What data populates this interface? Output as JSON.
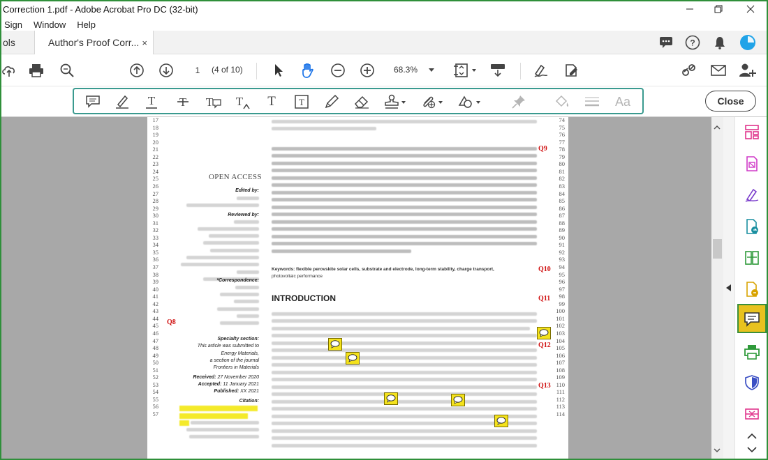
{
  "window": {
    "title": "Correction 1.pdf - Adobe Acrobat Pro DC (32-bit)"
  },
  "menu": [
    "Sign",
    "Window",
    "Help"
  ],
  "tabs": {
    "tools_label": "ols",
    "document_label": "Author's Proof Corr...",
    "close_glyph": "×"
  },
  "toolbar": {
    "page_current": "1",
    "page_count": "(4 of 10)",
    "zoom_value": "68.3%"
  },
  "comment_toolbar": {
    "close_label": "Close",
    "text_glyph": "T",
    "font_glyph": "Aa"
  },
  "document": {
    "open_access": "OPEN ACCESS",
    "edited_by": "Edited by:",
    "reviewed_by": "Reviewed by:",
    "correspondence": "*Correspondence:",
    "specialty_section": "Specialty section:",
    "specialty_line1": "This article was submitted to",
    "specialty_line2": "Energy Materials,",
    "specialty_line3": "a section of the journal",
    "specialty_line4": "Frontiers in Materials",
    "received_label": "Received:",
    "received_value": "27 November 2020",
    "accepted_label": "Accepted:",
    "accepted_value": "11 January 2021",
    "published_label": "Published:",
    "published_value": "XX 2021",
    "citation": "Citation:",
    "keywords_label": "Keywords:",
    "keywords_text": "flexible perovskite solar cells, substrate and electrode, long-term stability, charge transport,",
    "keywords_text2": "photovoltaic performance",
    "introduction": "INTRODUCTION",
    "queries": [
      "Q9",
      "Q10",
      "Q11",
      "Q8",
      "Q12",
      "Q13"
    ],
    "left_line_numbers": [
      "17",
      "18",
      "19",
      "20",
      "21",
      "22",
      "23",
      "24",
      "25",
      "26",
      "27",
      "28",
      "29",
      "30",
      "31",
      "32",
      "33",
      "34",
      "35",
      "36",
      "37",
      "38",
      "39",
      "40",
      "41",
      "42",
      "43",
      "44",
      "45",
      "46",
      "47",
      "48",
      "49",
      "50",
      "51",
      "52",
      "53",
      "54",
      "55",
      "56",
      "57"
    ],
    "right_line_numbers": [
      "74",
      "75",
      "76",
      "77",
      "78",
      "79",
      "80",
      "81",
      "82",
      "83",
      "84",
      "85",
      "86",
      "87",
      "88",
      "89",
      "90",
      "91",
      "92",
      "93",
      "94",
      "95",
      "96",
      "97",
      "98",
      "99",
      "100",
      "101",
      "102",
      "103",
      "104",
      "105",
      "106",
      "107",
      "108",
      "109",
      "110",
      "111",
      "112",
      "113",
      "114"
    ]
  },
  "colors": {
    "accent_teal": "#3a9a8f",
    "window_border": "#2f8f3a",
    "comment_active": "#e8c21f",
    "query_red": "#d01010",
    "note_yellow": "#f4e21c"
  }
}
